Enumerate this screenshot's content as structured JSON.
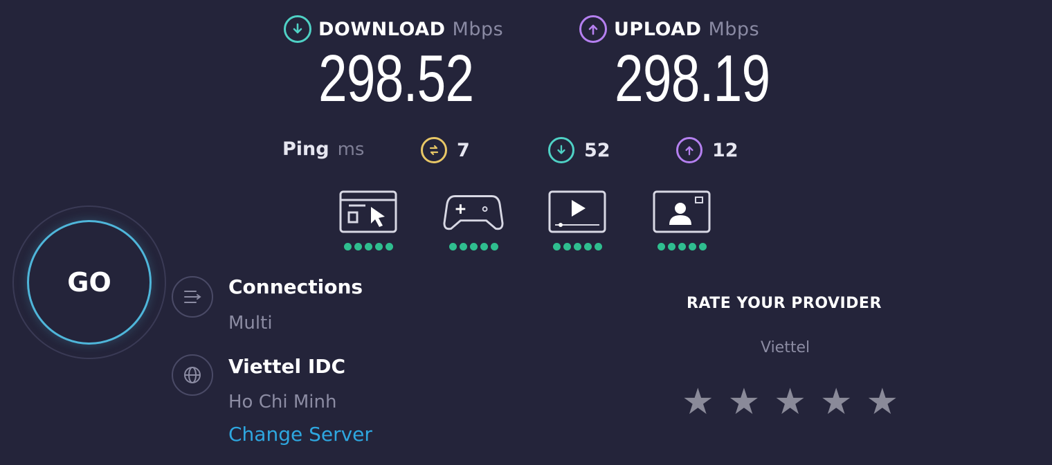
{
  "download": {
    "label": "DOWNLOAD",
    "unit": "Mbps",
    "value": "298.52",
    "icon": "download-arrow-icon"
  },
  "upload": {
    "label": "UPLOAD",
    "unit": "Mbps",
    "value": "298.19",
    "icon": "upload-arrow-icon"
  },
  "ping": {
    "label": "Ping",
    "unit": "ms",
    "idle": {
      "value": "7",
      "icon": "idle-latency-icon"
    },
    "download": {
      "value": "52",
      "icon": "download-latency-icon"
    },
    "upload": {
      "value": "12",
      "icon": "upload-latency-icon"
    }
  },
  "quality": [
    {
      "icon": "web-browsing-icon",
      "rating": 5
    },
    {
      "icon": "gaming-controller-icon",
      "rating": 5
    },
    {
      "icon": "video-streaming-icon",
      "rating": 5
    },
    {
      "icon": "video-call-icon",
      "rating": 5
    }
  ],
  "go_label": "GO",
  "connections": {
    "title": "Connections",
    "value": "Multi"
  },
  "server": {
    "title": "Viettel IDC",
    "location": "Ho Chi Minh",
    "change_label": "Change Server"
  },
  "rate": {
    "title": "RATE YOUR PROVIDER",
    "provider": "Viettel",
    "stars": 5
  },
  "colors": {
    "background": "#24243a",
    "download": "#4fd1c5",
    "upload": "#b580f0",
    "idle": "#e8c766",
    "go_ring": "#4fb6da",
    "link": "#2ea7e0",
    "rating_dot": "#2fbe8f"
  }
}
